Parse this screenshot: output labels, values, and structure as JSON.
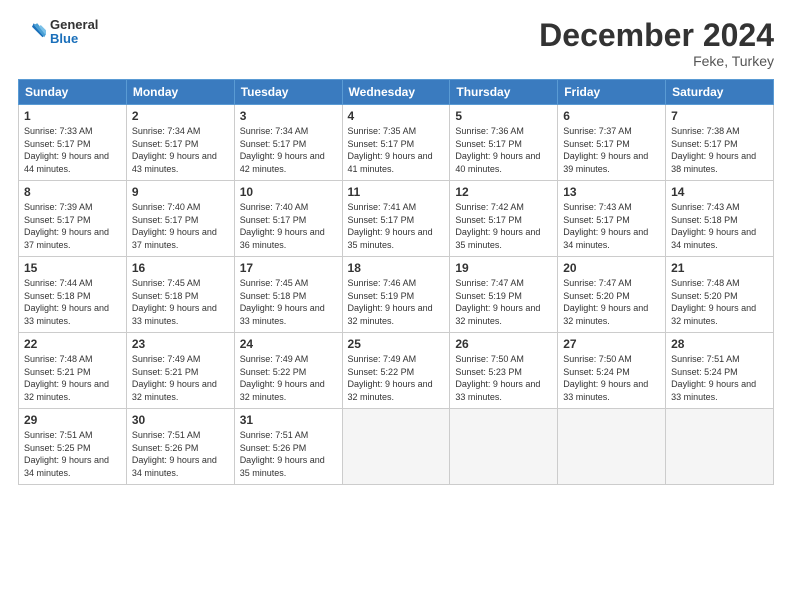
{
  "header": {
    "logo_general": "General",
    "logo_blue": "Blue",
    "month_title": "December 2024",
    "location": "Feke, Turkey"
  },
  "days_of_week": [
    "Sunday",
    "Monday",
    "Tuesday",
    "Wednesday",
    "Thursday",
    "Friday",
    "Saturday"
  ],
  "weeks": [
    [
      {
        "day": "1",
        "sunrise": "7:33 AM",
        "sunset": "5:17 PM",
        "daylight": "9 hours and 44 minutes."
      },
      {
        "day": "2",
        "sunrise": "7:34 AM",
        "sunset": "5:17 PM",
        "daylight": "9 hours and 43 minutes."
      },
      {
        "day": "3",
        "sunrise": "7:34 AM",
        "sunset": "5:17 PM",
        "daylight": "9 hours and 42 minutes."
      },
      {
        "day": "4",
        "sunrise": "7:35 AM",
        "sunset": "5:17 PM",
        "daylight": "9 hours and 41 minutes."
      },
      {
        "day": "5",
        "sunrise": "7:36 AM",
        "sunset": "5:17 PM",
        "daylight": "9 hours and 40 minutes."
      },
      {
        "day": "6",
        "sunrise": "7:37 AM",
        "sunset": "5:17 PM",
        "daylight": "9 hours and 39 minutes."
      },
      {
        "day": "7",
        "sunrise": "7:38 AM",
        "sunset": "5:17 PM",
        "daylight": "9 hours and 38 minutes."
      }
    ],
    [
      {
        "day": "8",
        "sunrise": "7:39 AM",
        "sunset": "5:17 PM",
        "daylight": "9 hours and 37 minutes."
      },
      {
        "day": "9",
        "sunrise": "7:40 AM",
        "sunset": "5:17 PM",
        "daylight": "9 hours and 37 minutes."
      },
      {
        "day": "10",
        "sunrise": "7:40 AM",
        "sunset": "5:17 PM",
        "daylight": "9 hours and 36 minutes."
      },
      {
        "day": "11",
        "sunrise": "7:41 AM",
        "sunset": "5:17 PM",
        "daylight": "9 hours and 35 minutes."
      },
      {
        "day": "12",
        "sunrise": "7:42 AM",
        "sunset": "5:17 PM",
        "daylight": "9 hours and 35 minutes."
      },
      {
        "day": "13",
        "sunrise": "7:43 AM",
        "sunset": "5:17 PM",
        "daylight": "9 hours and 34 minutes."
      },
      {
        "day": "14",
        "sunrise": "7:43 AM",
        "sunset": "5:18 PM",
        "daylight": "9 hours and 34 minutes."
      }
    ],
    [
      {
        "day": "15",
        "sunrise": "7:44 AM",
        "sunset": "5:18 PM",
        "daylight": "9 hours and 33 minutes."
      },
      {
        "day": "16",
        "sunrise": "7:45 AM",
        "sunset": "5:18 PM",
        "daylight": "9 hours and 33 minutes."
      },
      {
        "day": "17",
        "sunrise": "7:45 AM",
        "sunset": "5:18 PM",
        "daylight": "9 hours and 33 minutes."
      },
      {
        "day": "18",
        "sunrise": "7:46 AM",
        "sunset": "5:19 PM",
        "daylight": "9 hours and 32 minutes."
      },
      {
        "day": "19",
        "sunrise": "7:47 AM",
        "sunset": "5:19 PM",
        "daylight": "9 hours and 32 minutes."
      },
      {
        "day": "20",
        "sunrise": "7:47 AM",
        "sunset": "5:20 PM",
        "daylight": "9 hours and 32 minutes."
      },
      {
        "day": "21",
        "sunrise": "7:48 AM",
        "sunset": "5:20 PM",
        "daylight": "9 hours and 32 minutes."
      }
    ],
    [
      {
        "day": "22",
        "sunrise": "7:48 AM",
        "sunset": "5:21 PM",
        "daylight": "9 hours and 32 minutes."
      },
      {
        "day": "23",
        "sunrise": "7:49 AM",
        "sunset": "5:21 PM",
        "daylight": "9 hours and 32 minutes."
      },
      {
        "day": "24",
        "sunrise": "7:49 AM",
        "sunset": "5:22 PM",
        "daylight": "9 hours and 32 minutes."
      },
      {
        "day": "25",
        "sunrise": "7:49 AM",
        "sunset": "5:22 PM",
        "daylight": "9 hours and 32 minutes."
      },
      {
        "day": "26",
        "sunrise": "7:50 AM",
        "sunset": "5:23 PM",
        "daylight": "9 hours and 33 minutes."
      },
      {
        "day": "27",
        "sunrise": "7:50 AM",
        "sunset": "5:24 PM",
        "daylight": "9 hours and 33 minutes."
      },
      {
        "day": "28",
        "sunrise": "7:51 AM",
        "sunset": "5:24 PM",
        "daylight": "9 hours and 33 minutes."
      }
    ],
    [
      {
        "day": "29",
        "sunrise": "7:51 AM",
        "sunset": "5:25 PM",
        "daylight": "9 hours and 34 minutes."
      },
      {
        "day": "30",
        "sunrise": "7:51 AM",
        "sunset": "5:26 PM",
        "daylight": "9 hours and 34 minutes."
      },
      {
        "day": "31",
        "sunrise": "7:51 AM",
        "sunset": "5:26 PM",
        "daylight": "9 hours and 35 minutes."
      },
      null,
      null,
      null,
      null
    ]
  ],
  "labels": {
    "sunrise": "Sunrise:",
    "sunset": "Sunset:",
    "daylight": "Daylight:"
  }
}
